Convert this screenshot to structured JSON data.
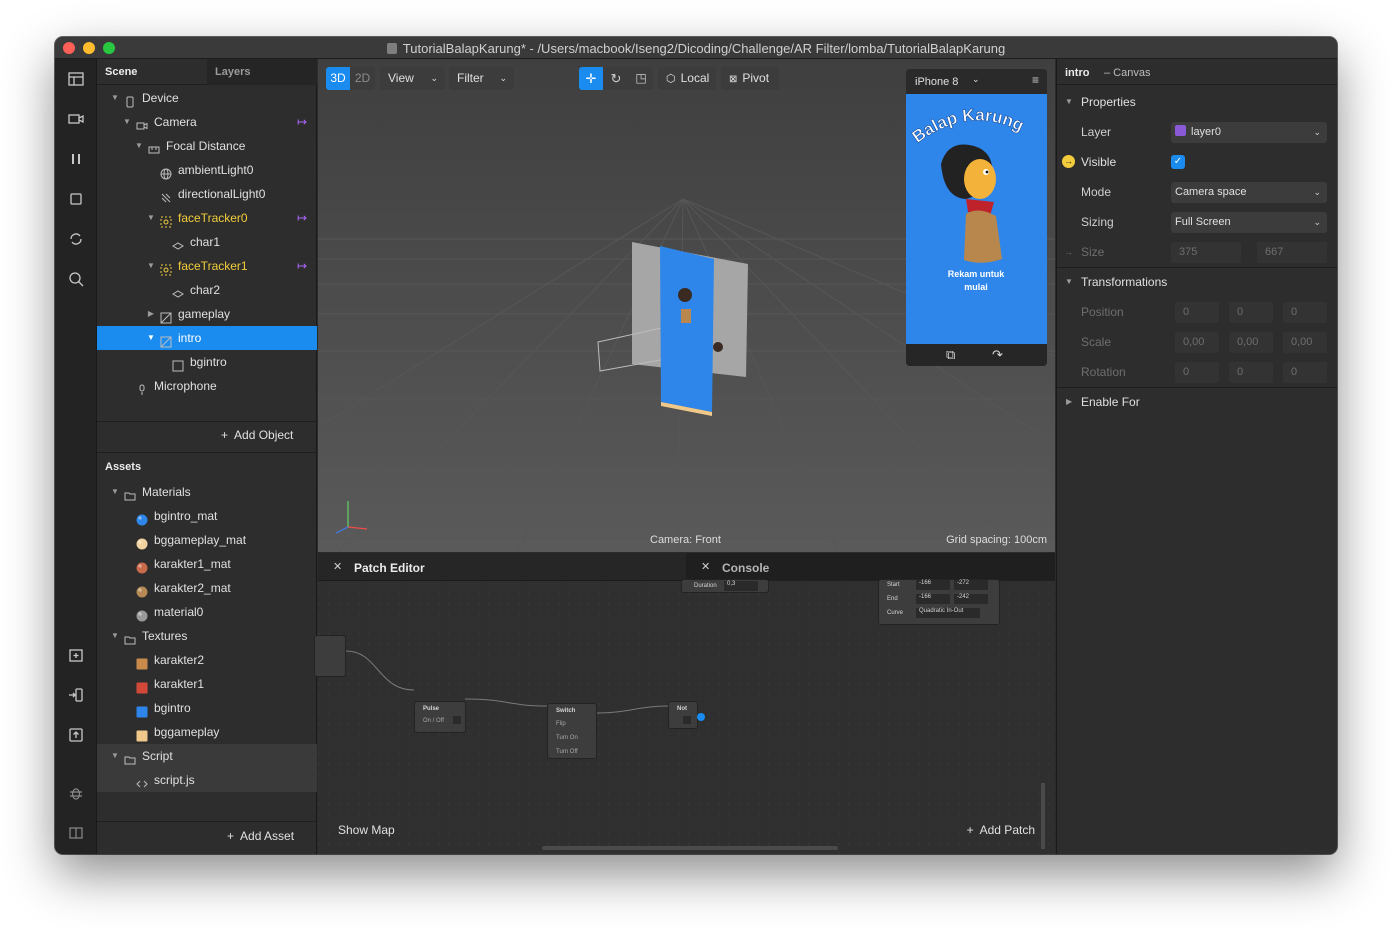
{
  "window": {
    "title": "TutorialBalapKarung* - /Users/macbook/Iseng2/Dicoding/Challenge/AR Filter/lomba/TutorialBalapKarung"
  },
  "scene_panel": {
    "tabs": [
      "Scene",
      "Layers"
    ],
    "tree": [
      {
        "label": "Device",
        "indent": 0,
        "caret": "open",
        "icon": "device-icon"
      },
      {
        "label": "Camera",
        "indent": 1,
        "caret": "open",
        "icon": "camera-icon",
        "link": true
      },
      {
        "label": "Focal Distance",
        "indent": 2,
        "caret": "open",
        "icon": "focal-distance-icon"
      },
      {
        "label": "ambientLight0",
        "indent": 3,
        "caret": "none",
        "icon": "globe-icon"
      },
      {
        "label": "directionalLight0",
        "indent": 3,
        "caret": "none",
        "icon": "directional-light-icon"
      },
      {
        "label": "faceTracker0",
        "indent": 3,
        "caret": "open",
        "icon": "face-tracker-icon",
        "highlight": true,
        "link": true
      },
      {
        "label": "char1",
        "indent": 4,
        "caret": "none",
        "icon": "plane-icon"
      },
      {
        "label": "faceTracker1",
        "indent": 3,
        "caret": "open",
        "icon": "face-tracker-icon",
        "highlight": true,
        "link": true
      },
      {
        "label": "char2",
        "indent": 4,
        "caret": "none",
        "icon": "plane-icon"
      },
      {
        "label": "gameplay",
        "indent": 3,
        "caret": "closed",
        "icon": "canvas-icon"
      },
      {
        "label": "intro",
        "indent": 3,
        "caret": "open",
        "icon": "canvas-icon",
        "selected": true
      },
      {
        "label": "bgintro",
        "indent": 4,
        "caret": "none",
        "icon": "rectangle-icon"
      },
      {
        "label": "Microphone",
        "indent": 1,
        "caret": "none",
        "icon": "microphone-icon"
      }
    ],
    "add_object": "Add Object"
  },
  "assets_panel": {
    "title": "Assets",
    "tree": [
      {
        "label": "Materials",
        "indent": 0,
        "caret": "open",
        "icon": "folder-icon"
      },
      {
        "label": "bgintro_mat",
        "indent": 1,
        "caret": "none",
        "icon": "material-bgintro-icon",
        "color": "#2f86ea"
      },
      {
        "label": "bggameplay_mat",
        "indent": 1,
        "caret": "none",
        "icon": "material-bggameplay-icon",
        "color": "#f3d3a0"
      },
      {
        "label": "karakter1_mat",
        "indent": 1,
        "caret": "none",
        "icon": "material-karakter1-icon",
        "color": "#c96a4a"
      },
      {
        "label": "karakter2_mat",
        "indent": 1,
        "caret": "none",
        "icon": "material-karakter2-icon",
        "color": "#b68a55"
      },
      {
        "label": "material0",
        "indent": 1,
        "caret": "none",
        "icon": "material-sphere-icon",
        "color": "#9a9a9a"
      },
      {
        "label": "Textures",
        "indent": 0,
        "caret": "open",
        "icon": "folder-icon"
      },
      {
        "label": "karakter2",
        "indent": 1,
        "caret": "none",
        "icon": "texture-karakter2-icon",
        "color": "#c98b4c"
      },
      {
        "label": "karakter1",
        "indent": 1,
        "caret": "none",
        "icon": "texture-karakter1-icon",
        "color": "#d2493a"
      },
      {
        "label": "bgintro",
        "indent": 1,
        "caret": "none",
        "icon": "texture-bgintro-icon",
        "color": "#2f86ea"
      },
      {
        "label": "bggameplay",
        "indent": 1,
        "caret": "none",
        "icon": "texture-bggameplay-icon",
        "color": "#f0c98a"
      },
      {
        "label": "Script",
        "indent": 0,
        "caret": "open",
        "icon": "folder-icon",
        "dim": true
      },
      {
        "label": "script.js",
        "indent": 1,
        "caret": "none",
        "icon": "code-icon",
        "dim": true
      }
    ],
    "add_asset": "Add Asset"
  },
  "viewport": {
    "mode_3d": "3D",
    "mode_2d": "2D",
    "view_label": "View",
    "filter_label": "Filter",
    "local_label": "Local",
    "pivot_label": "Pivot",
    "camera_label": "Camera: Front",
    "grid_label": "Grid spacing: 100cm"
  },
  "simulator": {
    "device": "iPhone 8",
    "headline": "Balap Karung",
    "prompt_line1": "Rekam untuk",
    "prompt_line2": "mulai"
  },
  "patch_editor": {
    "tab_patch": "Patch Editor",
    "tab_console": "Console",
    "show_map": "Show Map",
    "add_patch": "Add Patch",
    "nodes": {
      "pulse": {
        "title": "Pulse",
        "port": "On / Off"
      },
      "switch": {
        "title": "Switch",
        "ports": [
          "Flip",
          "Turn On",
          "Turn Off"
        ]
      },
      "not": {
        "title": "Not"
      },
      "duration": {
        "label": "Duration",
        "value": "0,3"
      },
      "transition": {
        "start_label": "Start",
        "start_values": [
          "-166",
          "-272"
        ],
        "end_label": "End",
        "end_values": [
          "-166",
          "-242"
        ],
        "curve_label": "Curve",
        "curve_value": "Quadratic In-Out"
      }
    }
  },
  "inspector": {
    "object_name": "intro",
    "object_type": "– Canvas",
    "properties_header": "Properties",
    "layer_label": "Layer",
    "layer_value": "layer0",
    "layer_color": "#8a5ad6",
    "visible_label": "Visible",
    "visible_checked": true,
    "mode_label": "Mode",
    "mode_value": "Camera space",
    "sizing_label": "Sizing",
    "sizing_value": "Full Screen",
    "size_label": "Size",
    "size_w": "375",
    "size_h": "667",
    "transformations_header": "Transformations",
    "position_label": "Position",
    "position_values": [
      "0",
      "0",
      "0"
    ],
    "scale_label": "Scale",
    "scale_values": [
      "0,00",
      "0,00",
      "0,00"
    ],
    "rotation_label": "Rotation",
    "rotation_values": [
      "0",
      "0",
      "0"
    ],
    "enable_for": "Enable For"
  },
  "colors": {
    "accent": "#1a8cf0",
    "highlight_text": "#f2cc3c",
    "link_purple": "#b065ff"
  }
}
